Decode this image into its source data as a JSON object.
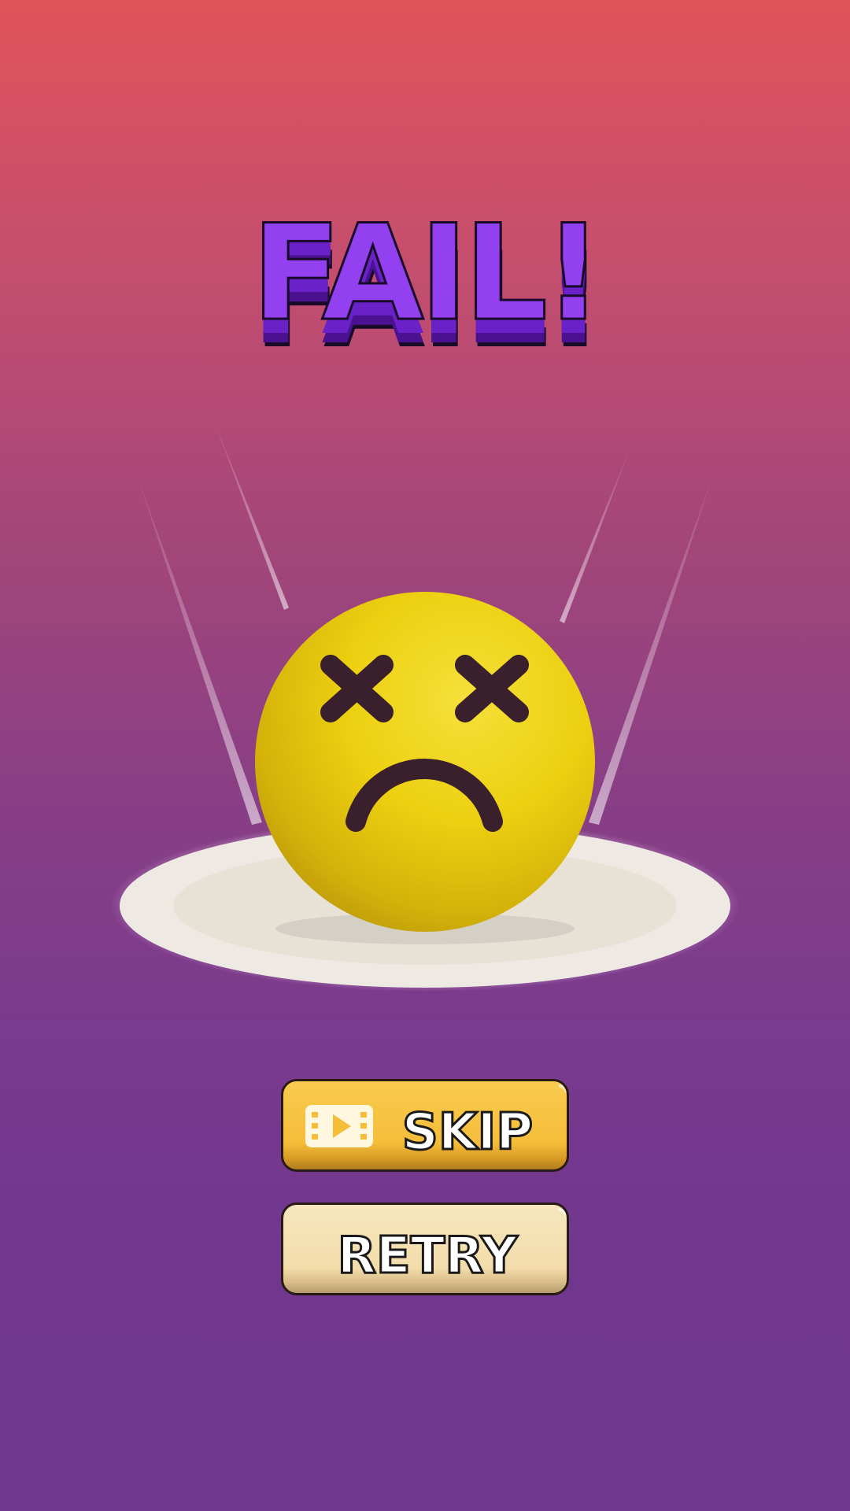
{
  "title": "FAIL!",
  "buttons": {
    "skip_label": "SKIP",
    "retry_label": "RETRY"
  },
  "icons": {
    "skip_icon": "video-ad-icon",
    "face": "dizzy-sad-face"
  },
  "colors": {
    "background_top": "#e0535a",
    "background_bottom": "#70378f",
    "title_fill": "#9240f0",
    "title_shadow": "#5b16a8",
    "ball": "#f0d21a",
    "face_features": "#3a1f2c",
    "skip_button": "#f5bd3a",
    "retry_button": "#f3dcaa",
    "pedestal": "#efe9e4"
  }
}
